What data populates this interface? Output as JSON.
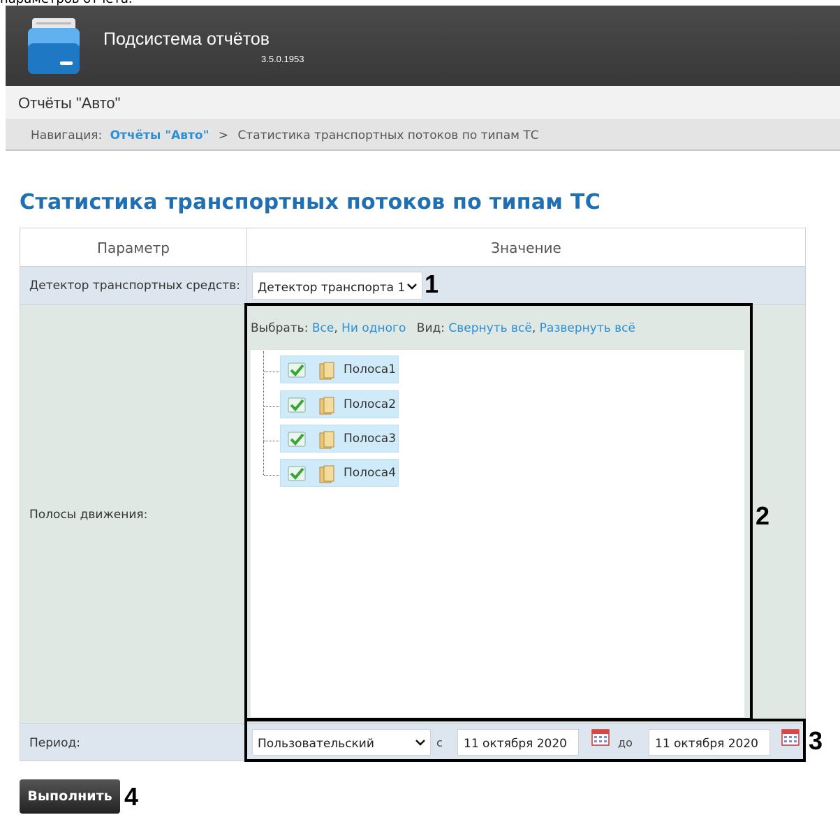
{
  "cut_off_text": "параметров отчета.",
  "app": {
    "title": "Подсистема отчётов",
    "version": "3.5.0.1953"
  },
  "section": {
    "title": "Отчёты \"Авто\""
  },
  "breadcrumb": {
    "prefix": "Навигация:",
    "link": "Отчёты \"Авто\"",
    "separator": ">",
    "current": "Статистика транспортных потоков по типам ТС"
  },
  "page_title": "Статистика транспортных потоков по типам ТС",
  "table": {
    "header_param": "Параметр",
    "header_value": "Значение"
  },
  "detector": {
    "label": "Детектор транспортных средств:",
    "selected": "Детектор транспорта 1"
  },
  "lanes": {
    "label": "Полосы движения:",
    "select_label": "Выбрать:",
    "select_all": "Все",
    "select_none": "Ни одного",
    "view_label": "Вид:",
    "collapse_all": "Свернуть всё",
    "expand_all": "Развернуть всё",
    "items": [
      {
        "label": "Полоса1",
        "checked": true
      },
      {
        "label": "Полоса2",
        "checked": true
      },
      {
        "label": "Полоса3",
        "checked": true
      },
      {
        "label": "Полоса4",
        "checked": true
      }
    ]
  },
  "period": {
    "label": "Период:",
    "selected": "Пользовательский",
    "from_label": "с",
    "from_date": "11 октября 2020",
    "to_label": "до",
    "to_date": "11 октября 2020"
  },
  "run_button": "Выполнить",
  "markers": {
    "m1": "1",
    "m2": "2",
    "m3": "3",
    "m4": "4"
  },
  "colors": {
    "header_bg": "#3f3f3f",
    "title_blue": "#1f6fb2",
    "link_blue": "#2b8fd6",
    "tree_item_bg": "#cfeaf8",
    "check_green": "#3aa43a"
  },
  "icons": {
    "app": "folder-archive-icon",
    "checkbox": "checkmark-icon",
    "lane": "folder-icon",
    "calendar": "calendar-icon",
    "dropdown": "chevron-down-icon"
  }
}
